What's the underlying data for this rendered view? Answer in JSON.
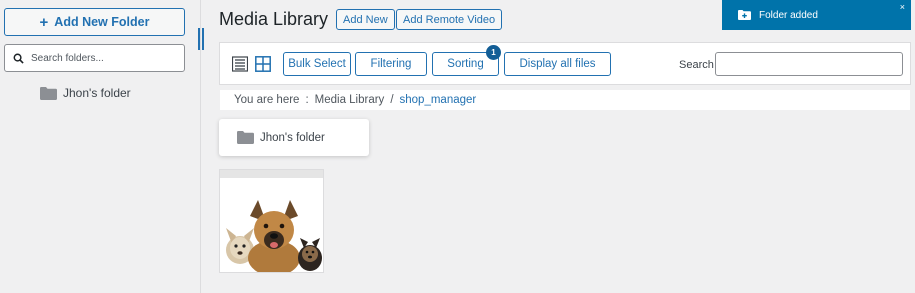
{
  "sidebar": {
    "add_folder_label": "Add New Folder",
    "search_placeholder": "Search folders...",
    "folders": [
      {
        "label": "Jhon's folder"
      }
    ]
  },
  "header": {
    "title": "Media Library",
    "add_new_label": "Add New",
    "add_remote_label": "Add Remote Video"
  },
  "toolbar": {
    "bulk_select_label": "Bulk Select",
    "filtering_label": "Filtering",
    "sorting_label": "Sorting",
    "sorting_badge": "1",
    "display_all_label": "Display all files",
    "search_label": "Search",
    "search_value": ""
  },
  "breadcrumb": {
    "prefix": "You are here",
    "separator": ":",
    "root": "Media Library",
    "divider": "/",
    "current": "shop_manager"
  },
  "content": {
    "folder_card_label": "Jhon's folder"
  },
  "notice": {
    "message": "Folder added",
    "close": "×"
  },
  "colors": {
    "accent": "#2271b1",
    "notice_bg": "#0073aa"
  }
}
